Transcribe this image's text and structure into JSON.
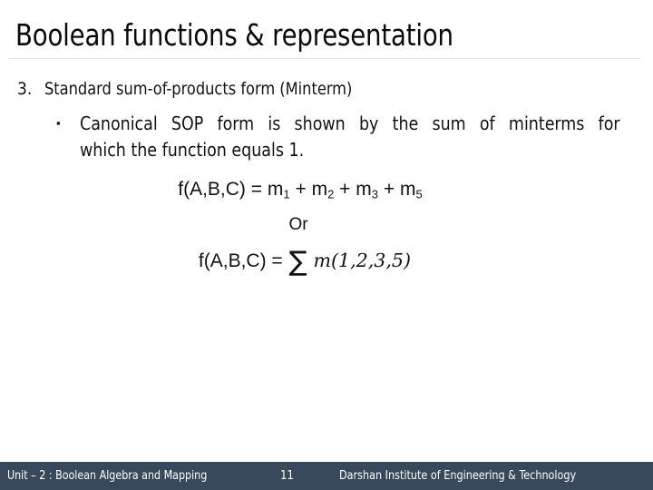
{
  "slide": {
    "title": "Boolean functions & representation",
    "background_color": "#ffffff",
    "rule_color": "#e2e2e4"
  },
  "content": {
    "numbered_item": {
      "marker": "3.",
      "text": "Standard sum-of-products form (Minterm)"
    },
    "sub_bullet": {
      "marker": "▪",
      "line1": "Canonical SOP form is shown by the sum of minterms for",
      "line2": "which the function equals 1."
    },
    "equations": {
      "equation1": {
        "lhs": "f(A,B,C) =",
        "term1_base": "m",
        "term1_sub": "1",
        "op1": "+",
        "term2_base": "m",
        "term2_sub": "2",
        "op2": "+",
        "term3_base": "m",
        "term3_sub": "3",
        "op3": "+",
        "term4_base": "m",
        "term4_sub": "5"
      },
      "connector": "Or",
      "equation2": {
        "lhs": "f(A,B,C) =",
        "sigma": "∑",
        "function": "m",
        "args": "(1,2,3,5)"
      }
    }
  },
  "footer": {
    "background_color": "#37495a",
    "text_color": "#ffffff",
    "unit_label": "Unit – 2 : Boolean Algebra and Mapping",
    "page_number": "11",
    "institute": "Darshan Institute of Engineering & Technology"
  }
}
